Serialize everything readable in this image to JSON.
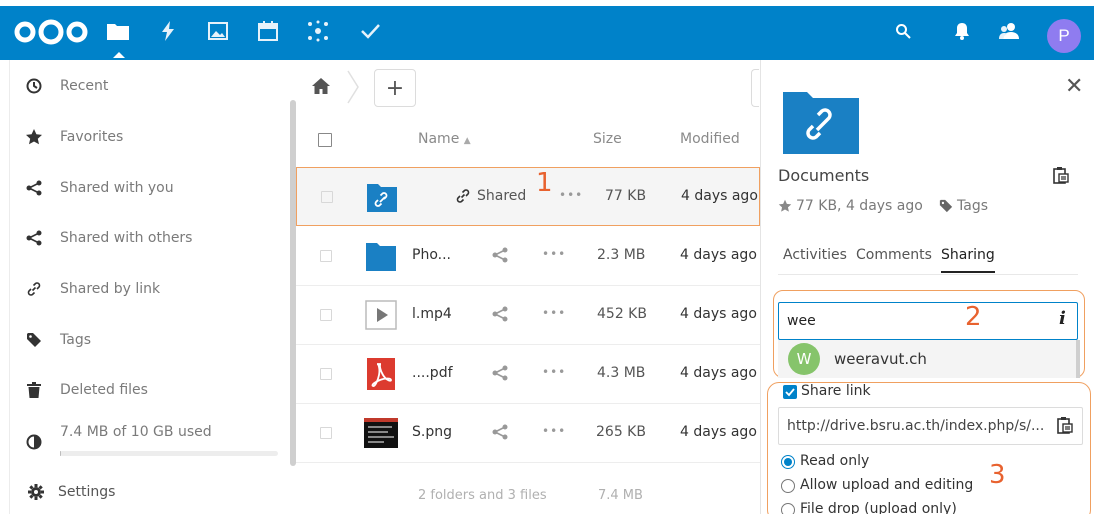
{
  "header": {
    "apps": [
      "files-icon",
      "activity-icon",
      "gallery-icon",
      "calendar-icon",
      "circles-icon",
      "tasks-icon"
    ],
    "right_icons": [
      "search-icon",
      "notifications-icon",
      "contacts-icon"
    ],
    "avatar_initial": "P",
    "brand_color": "#0082c9"
  },
  "nav": {
    "items": [
      {
        "label": "Recent",
        "icon": "clock-icon"
      },
      {
        "label": "Favorites",
        "icon": "star-icon"
      },
      {
        "label": "Shared with you",
        "icon": "share-icon"
      },
      {
        "label": "Shared with others",
        "icon": "share-icon"
      },
      {
        "label": "Shared by link",
        "icon": "link-icon"
      },
      {
        "label": "Tags",
        "icon": "tag-icon"
      },
      {
        "label": "Deleted files",
        "icon": "trash-icon"
      }
    ],
    "quota_label": "7.4 MB of 10 GB used",
    "quota_fraction": 0.001,
    "settings_label": "Settings"
  },
  "files": {
    "add_label": "+",
    "columns": {
      "name": "Name",
      "size": "Size",
      "modified": "Modified"
    },
    "rows": [
      {
        "name": "",
        "type": "shared-folder",
        "shared_label": "Shared",
        "size": "77 KB",
        "modified": "4 days ago"
      },
      {
        "name": "Pho...",
        "type": "folder",
        "size": "2.3 MB",
        "modified": "4 days ago"
      },
      {
        "name": "l.mp4",
        "type": "video",
        "size": "452 KB",
        "modified": "4 days ago"
      },
      {
        "name": "....pdf",
        "type": "pdf",
        "size": "4.3 MB",
        "modified": "4 days ago"
      },
      {
        "name": "S.png",
        "type": "image",
        "size": "265 KB",
        "modified": "4 days ago"
      }
    ],
    "more_label": "•••",
    "summary": "2 folders and 3 files",
    "summary_size": "7.4 MB"
  },
  "annotations": {
    "one": "1",
    "two": "2",
    "three": "3"
  },
  "sidebar": {
    "close_label": "✕",
    "title": "Documents",
    "meta": "77 KB, 4 days ago",
    "tags_label": "Tags",
    "tabs": [
      "Activities",
      "Comments",
      "Sharing"
    ],
    "search": {
      "value": "wee",
      "info": "i"
    },
    "suggestion": {
      "initial": "W",
      "name": "weeravut.ch"
    },
    "share_link_label": "Share link",
    "link_value": "http://drive.bsru.ac.th/index.php/s/...",
    "options": [
      "Read only",
      "Allow upload and editing",
      "File drop (upload only)"
    ]
  }
}
